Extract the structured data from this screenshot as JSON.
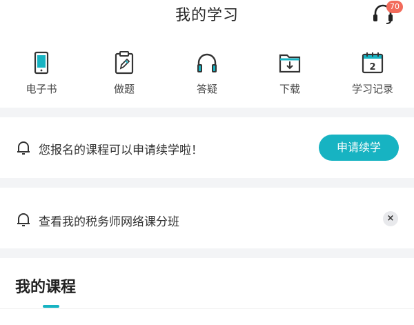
{
  "header": {
    "title": "我的学习",
    "badge_count": "70"
  },
  "quick_actions": [
    {
      "label": "电子书",
      "icon": "ebook-icon"
    },
    {
      "label": "做题",
      "icon": "practice-icon"
    },
    {
      "label": "答疑",
      "icon": "headphones-icon"
    },
    {
      "label": "下载",
      "icon": "download-folder-icon"
    },
    {
      "label": "学习记录",
      "icon": "calendar-icon"
    }
  ],
  "renew_notice": {
    "message": "您报名的课程可以申请续学啦！",
    "button": "申请续学"
  },
  "course_notice": {
    "message": "查看我的税务师网络课分班",
    "close": "×"
  },
  "courses": {
    "title": "我的课程"
  },
  "colors": {
    "accent": "#17b3c2",
    "badge": "#f26b5b",
    "gap": "#f3f4f6"
  }
}
